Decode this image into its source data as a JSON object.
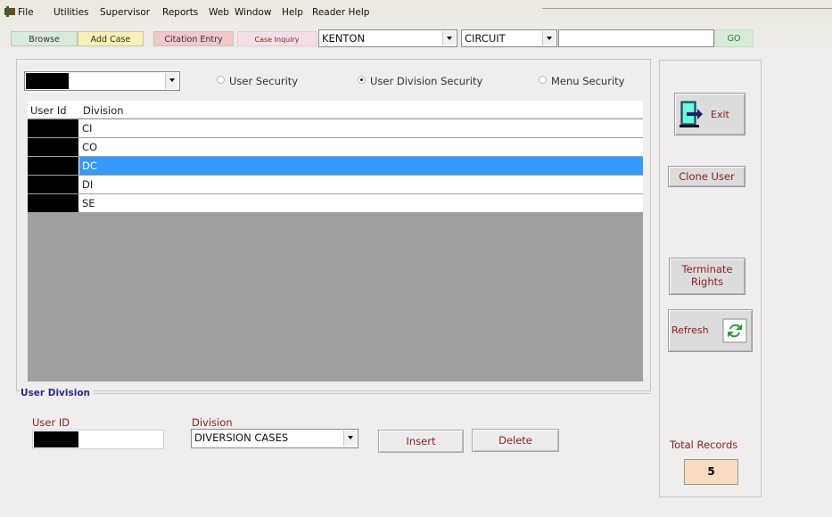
{
  "menu": {
    "items": [
      "File",
      "Utilities",
      "Supervisor",
      "Reports",
      "Web",
      "Window",
      "Help",
      "Reader Help"
    ]
  },
  "toolbar": {
    "browse": "Browse",
    "add_case": "Add Case",
    "citation_entry": "Citation Entry",
    "case_inquiry": "Case Inquiry",
    "county": "KENTON",
    "court": "CIRCUIT",
    "search_value": "",
    "go": "GO"
  },
  "security": {
    "options": [
      "User Security",
      "User Division Security",
      "Menu Security"
    ],
    "selected": "User Division Security"
  },
  "grid": {
    "columns": [
      "User Id",
      "Division"
    ],
    "rows": [
      {
        "division": "CI",
        "selected": false
      },
      {
        "division": "CO",
        "selected": false
      },
      {
        "division": "DC",
        "selected": true
      },
      {
        "division": "DI",
        "selected": false
      },
      {
        "division": "SE",
        "selected": false
      }
    ]
  },
  "user_division": {
    "section_title": "User Division",
    "user_id_label": "User ID",
    "division_label": "Division",
    "division_value": "DIVERSION CASES",
    "insert": "Insert",
    "delete": "Delete"
  },
  "side": {
    "exit": "Exit",
    "clone_user": "Clone User",
    "terminate_rights": "Terminate Rights",
    "refresh": "Refresh",
    "total_records_label": "Total Records",
    "total_records_value": "5"
  }
}
